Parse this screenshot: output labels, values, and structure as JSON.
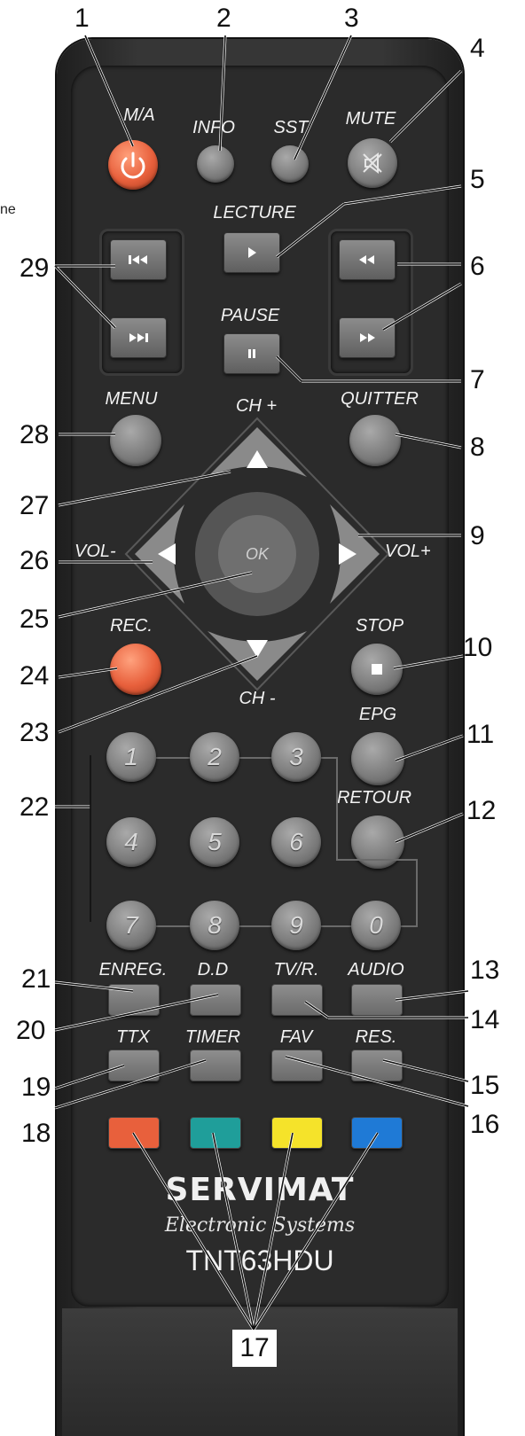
{
  "callouts": {
    "n1": "1",
    "n2": "2",
    "n3": "3",
    "n4": "4",
    "n5": "5",
    "n6": "6",
    "n7": "7",
    "n8": "8",
    "n9": "9",
    "n10": "10",
    "n11": "11",
    "n12": "12",
    "n13": "13",
    "n14": "14",
    "n15": "15",
    "n16": "16",
    "n17": "17",
    "n18": "18",
    "n19": "19",
    "n20": "20",
    "n21": "21",
    "n22": "22",
    "n23": "23",
    "n24": "24",
    "n25": "25",
    "n26": "26",
    "n27": "27",
    "n28": "28",
    "n29": "29"
  },
  "side_text": "ne",
  "labels": {
    "power": "M/A",
    "info": "INFO",
    "sst": "SST",
    "mute": "MUTE",
    "play": "LECTURE",
    "pause": "PAUSE",
    "menu": "MENU",
    "quit": "QUITTER",
    "ch_up": "CH +",
    "ch_down": "CH -",
    "vol_down": "VOL-",
    "vol_up": "VOL+",
    "ok": "OK",
    "rec": "REC.",
    "stop": "STOP",
    "epg": "EPG",
    "back": "RETOUR",
    "record": "ENREG.",
    "dd": "D.D",
    "tvr": "TV/R.",
    "audio": "AUDIO",
    "ttx": "TTX",
    "timer": "TIMER",
    "fav": "FAV",
    "res": "RES."
  },
  "numbers": [
    "1",
    "2",
    "3",
    "4",
    "5",
    "6",
    "7",
    "8",
    "9",
    "0"
  ],
  "brand": {
    "name": "SERVIMAT",
    "tagline": "Electronic Systems",
    "model": "TNT63HDU"
  },
  "colors": {
    "red": "#e8603c",
    "green": "#1f9e9a",
    "yellow": "#f5e32a",
    "blue": "#1f7ad6",
    "body": "#2b2b2b",
    "power": "#e8603c",
    "rec": "#e8603c"
  },
  "icons": {
    "power": "power-icon",
    "mute": "mute-icon",
    "prev": "skip-back-icon",
    "next": "skip-forward-icon",
    "rewind": "rewind-icon",
    "forward": "fast-forward-icon",
    "play": "play-icon",
    "pause": "pause-icon",
    "stop": "stop-icon"
  }
}
